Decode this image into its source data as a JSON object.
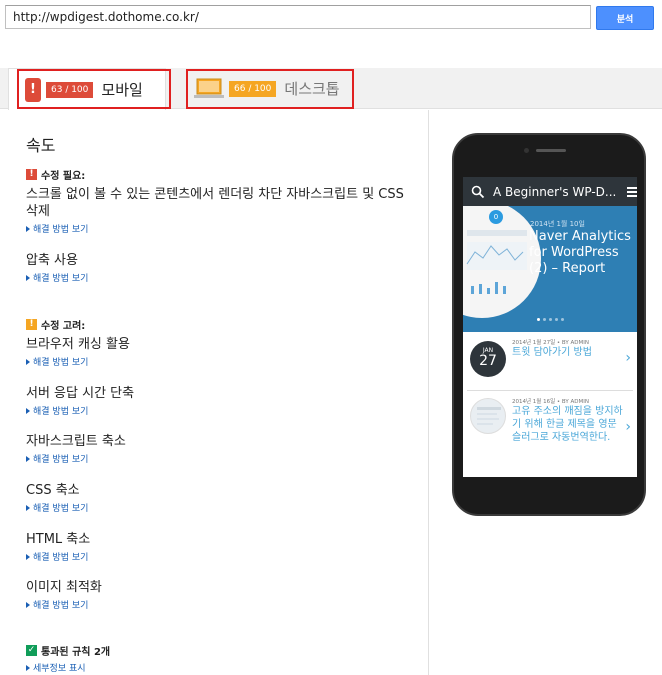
{
  "url_bar": {
    "value": "http://wpdigest.dothome.co.kr/"
  },
  "analyze_button": {
    "label": "분석"
  },
  "tabs": [
    {
      "score": "63 / 100",
      "label": "모바일",
      "status_color": "#dd4b39",
      "icon": "mobile-phone-icon",
      "active": true
    },
    {
      "score": "66 / 100",
      "label": "데스크톱",
      "status_color": "#f5a623",
      "icon": "laptop-icon",
      "active": false
    }
  ],
  "speed": {
    "title": "속도",
    "must_fix": {
      "label": "수정 필요:",
      "icon": "exclamation-icon",
      "rules": [
        {
          "title": "스크롤 없이 볼 수 있는 콘텐츠에서 렌더링 차단 자바스크립트 및 CSS 삭제",
          "link": "해결 방법 보기"
        },
        {
          "title": "압축 사용",
          "link": "해결 방법 보기"
        }
      ]
    },
    "consider_fixing": {
      "label": "수정 고려:",
      "icon": "exclamation-icon",
      "rules": [
        {
          "title": "브라우저 캐싱 활용",
          "link": "해결 방법 보기"
        },
        {
          "title": "서버 응답 시간 단축",
          "link": "해결 방법 보기"
        },
        {
          "title": "자바스크립트 축소",
          "link": "해결 방법 보기"
        },
        {
          "title": "CSS 축소",
          "link": "해결 방법 보기"
        },
        {
          "title": "HTML 축소",
          "link": "해결 방법 보기"
        },
        {
          "title": "이미지 최적화",
          "link": "해결 방법 보기"
        }
      ]
    },
    "passed": {
      "label": "통과된 규칙 2개",
      "icon": "checkmark-icon",
      "link": "세부정보 표시"
    }
  },
  "phone_preview": {
    "app_title": "A Beginner's WP-D...",
    "hero": {
      "badge": "0",
      "date": "2014년 1월 10일",
      "title": "Naver Analytics for WordPress (2) – Report"
    },
    "posts": [
      {
        "meta": "2014년 1월 27일 • BY ADMIN",
        "title": "트윗 담아가기 방법",
        "month": "JAN",
        "day": "27"
      },
      {
        "meta": "2014년 1월 16일 • BY ADMIN",
        "title": "고유 주소의 깨짐을 방지하기 위해 한글 제목을 영문 슬러그로 자동번역한다."
      }
    ]
  }
}
